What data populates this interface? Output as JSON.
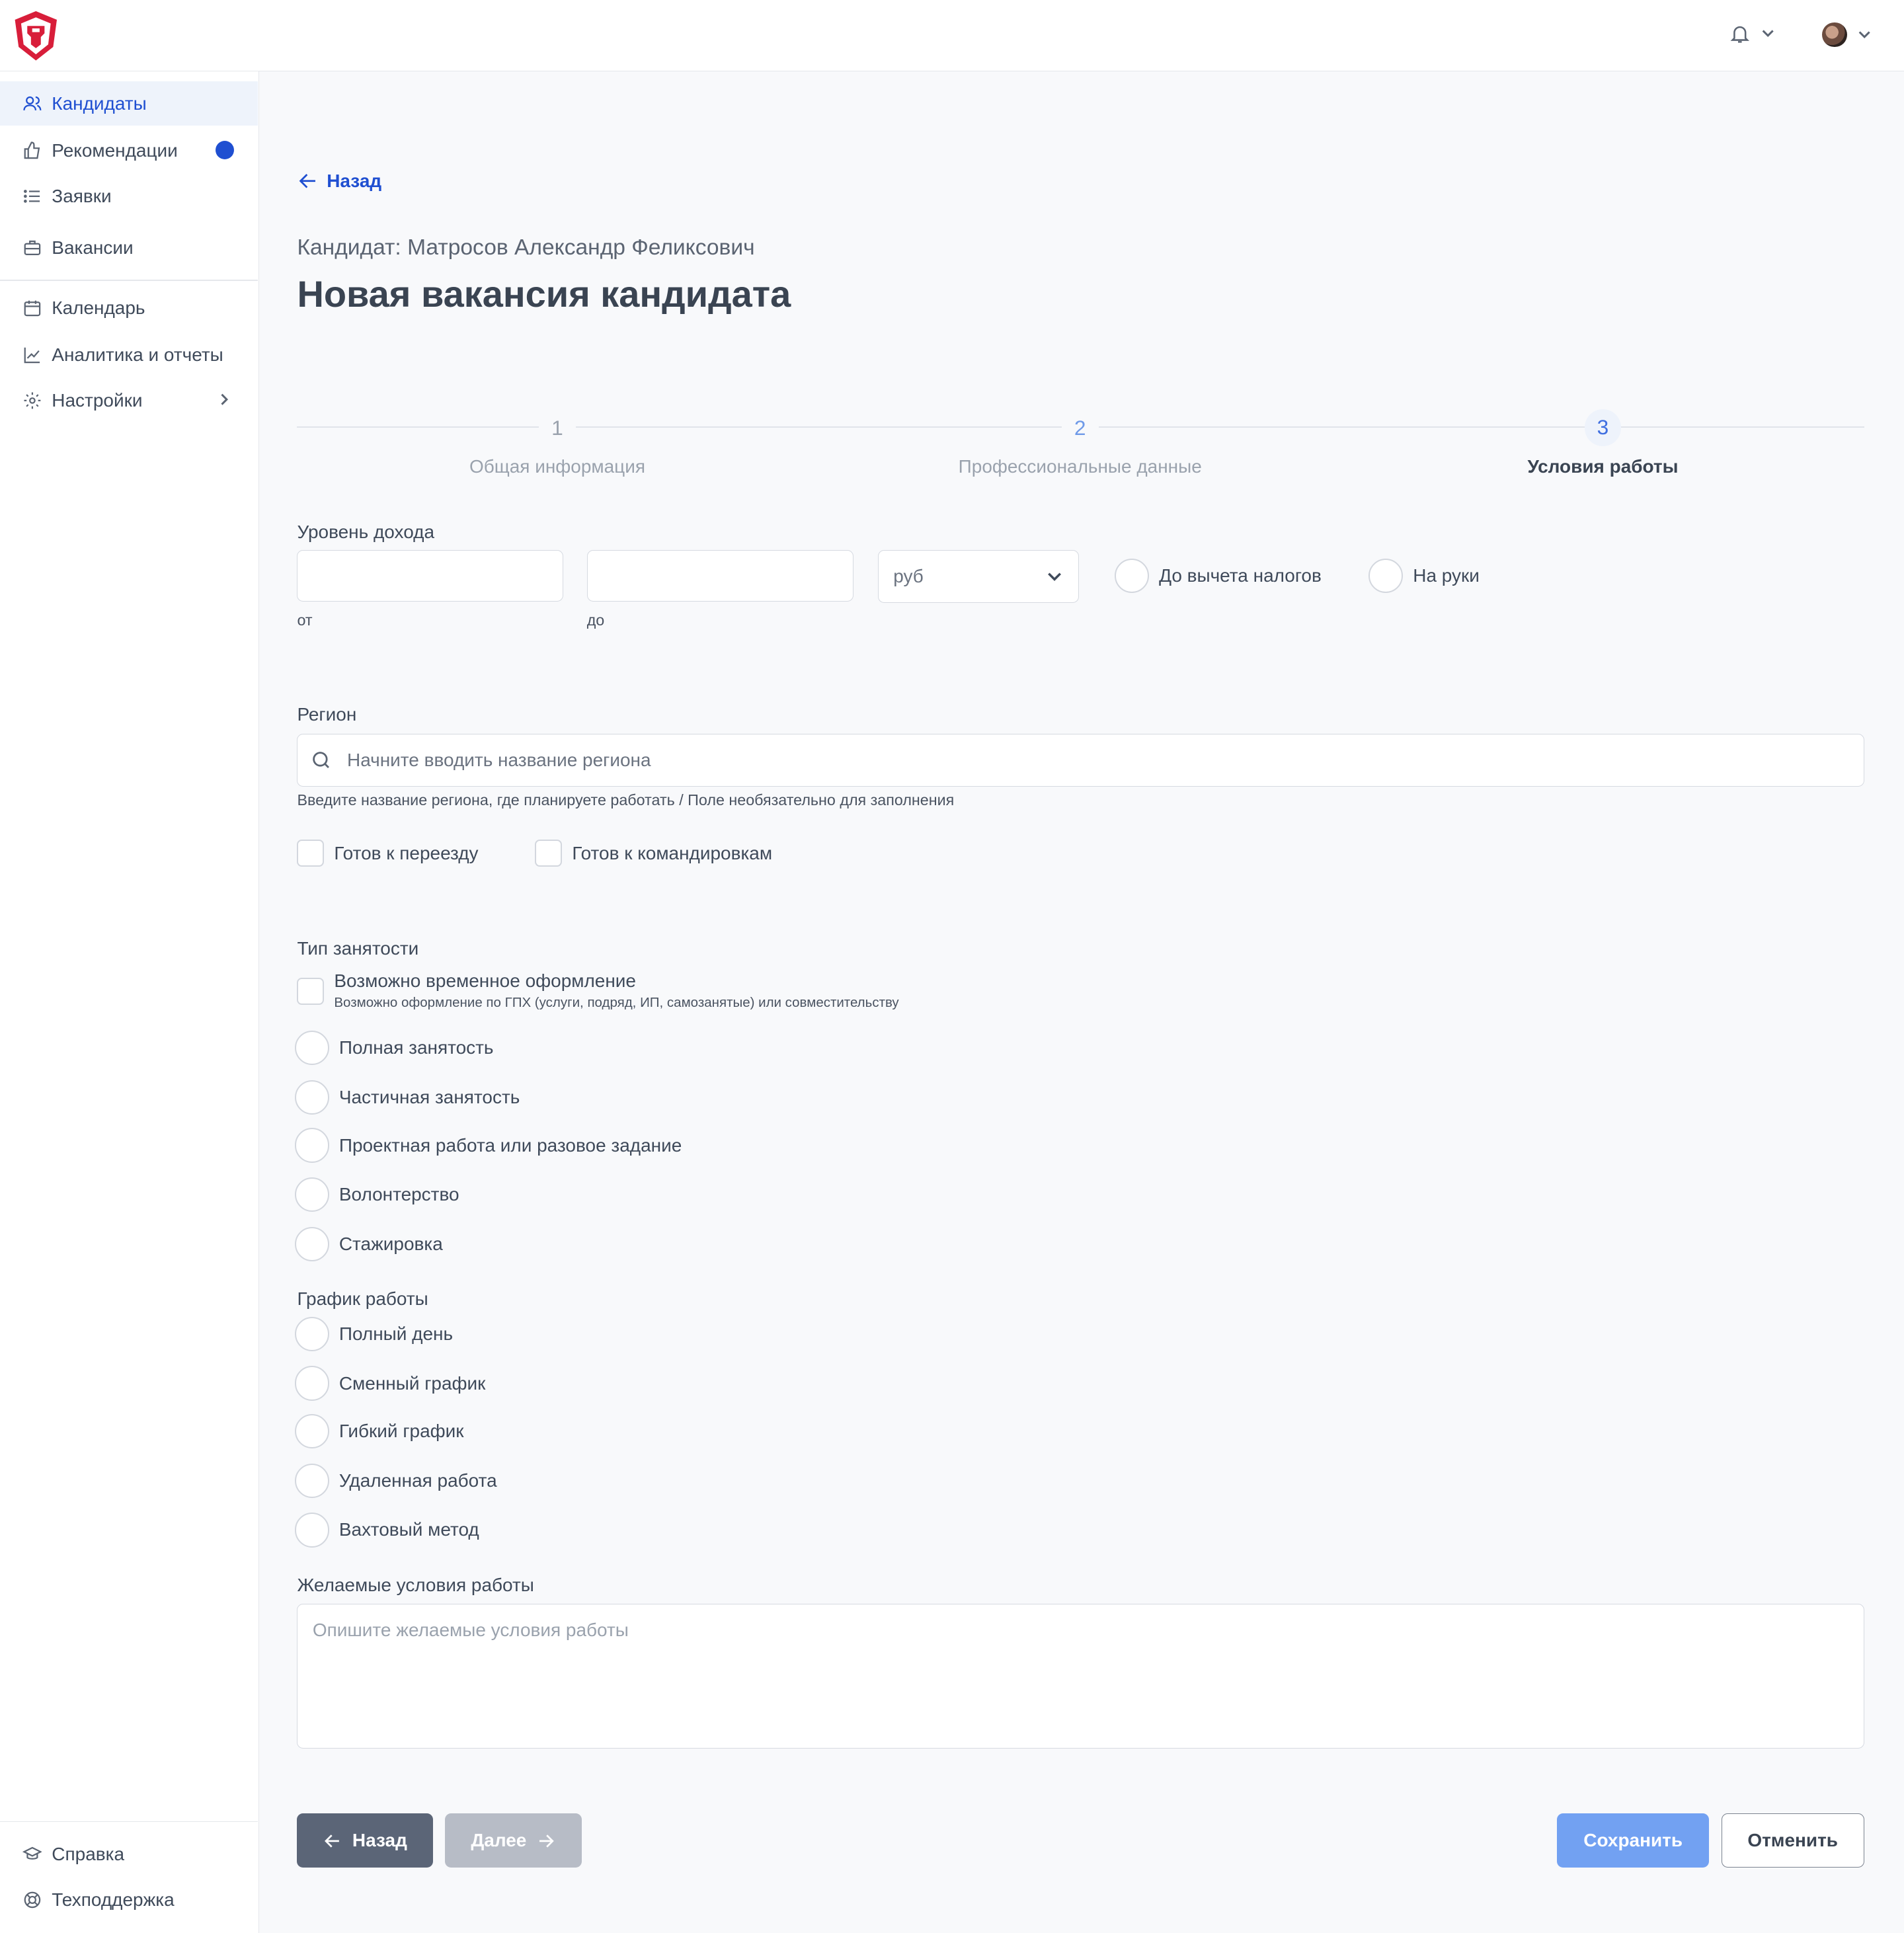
{
  "sidebar": {
    "items": [
      {
        "label": "Кандидаты",
        "icon": "users-icon"
      },
      {
        "label": "Рекомендации",
        "icon": "thumbs-up-icon"
      },
      {
        "label": "Заявки",
        "icon": "list-icon"
      },
      {
        "label": "Вакансии",
        "icon": "briefcase-icon"
      },
      {
        "label": "Календарь",
        "icon": "calendar-icon"
      },
      {
        "label": "Аналитика и отчеты",
        "icon": "chart-icon"
      },
      {
        "label": "Настройки",
        "icon": "gear-icon"
      }
    ],
    "bottom": [
      {
        "label": "Справка",
        "icon": "graduation-cap-icon"
      },
      {
        "label": "Техподдержка",
        "icon": "lifebuoy-icon"
      }
    ],
    "accent": "#1f4fd1"
  },
  "header": {
    "back_label": "Назад",
    "subtitle": "Кандидат: Матросов Александр Феликсович",
    "title": "Новая вакансия кандидата"
  },
  "stepper": {
    "steps": [
      {
        "num": "1",
        "label": "Общая информация"
      },
      {
        "num": "2",
        "label": "Профессиональные данные"
      },
      {
        "num": "3",
        "label": "Условия работы"
      }
    ],
    "current": 3
  },
  "income": {
    "label": "Уровень дохода",
    "from_value": "",
    "to_value": "",
    "from_hint": "от",
    "to_hint": "до",
    "currency": "руб",
    "gross_label": "До вычета налогов",
    "net_label": "На руки"
  },
  "region": {
    "label": "Регион",
    "placeholder": "Начните вводить название региона",
    "hint": "Введите название региона, где планируете работать / Поле необязательно для заполнения",
    "relocate_label": "Готов к переезду",
    "travel_label": "Готов к командировкам"
  },
  "employment": {
    "label": "Тип занятости",
    "temporary_label": "Возможно временное оформление",
    "temporary_hint": "Возможно оформление по ГПХ (услуги, подряд, ИП, самозанятые) или совместительству",
    "options": [
      "Полная занятость",
      "Частичная занятость",
      "Проектная работа или разовое задание",
      "Волонтерство",
      "Стажировка"
    ]
  },
  "schedule": {
    "label": "График работы",
    "options": [
      "Полный день",
      "Сменный график",
      "Гибкий график",
      "Удаленная работа",
      "Вахтовый метод"
    ]
  },
  "conditions": {
    "label": "Желаемые условия работы",
    "placeholder": "Опишите желаемые условия работы"
  },
  "buttons": {
    "back": "Назад",
    "next": "Далее",
    "save": "Сохранить",
    "cancel": "Отменить"
  }
}
